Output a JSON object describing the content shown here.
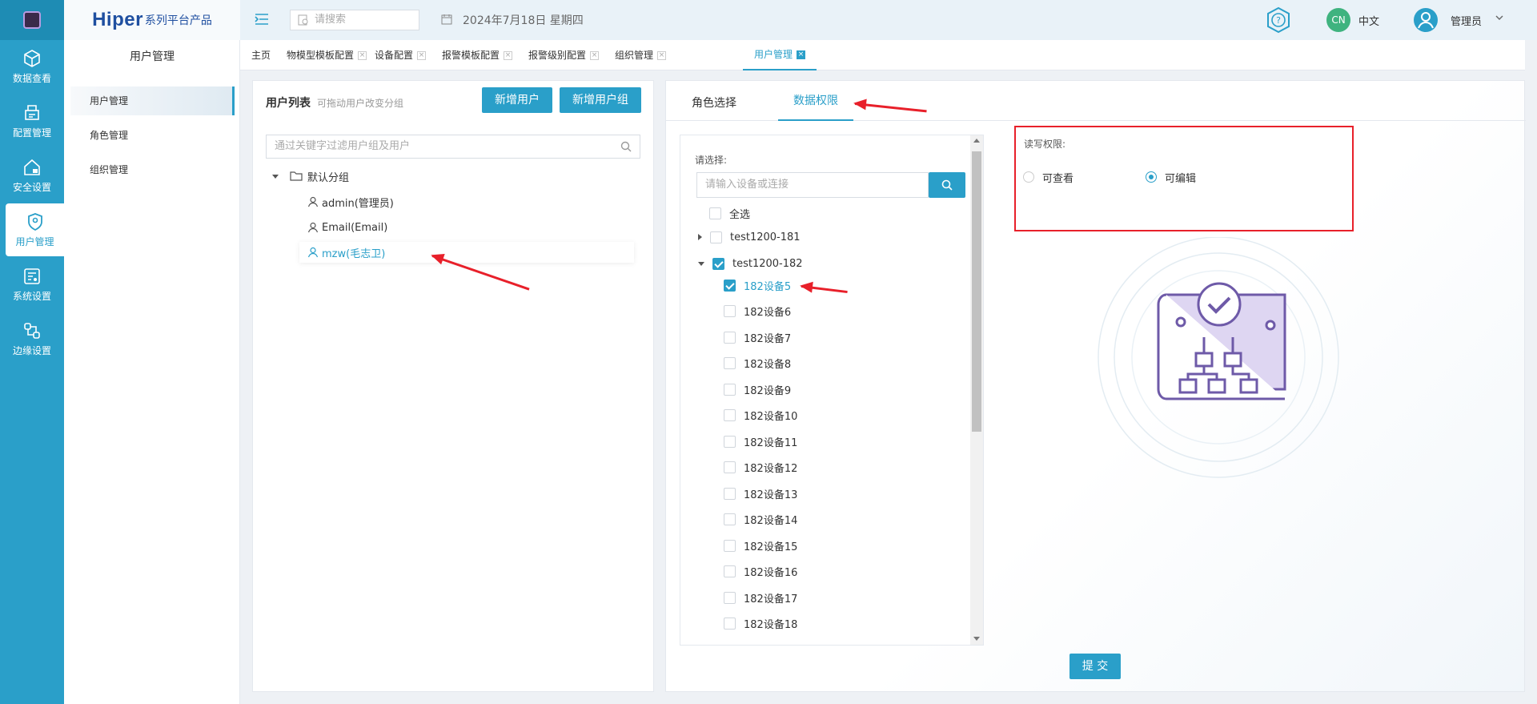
{
  "rail": {
    "items": [
      {
        "label": "数据查看",
        "icon": "cube-icon"
      },
      {
        "label": "配置管理",
        "icon": "printer-config-icon"
      },
      {
        "label": "安全设置",
        "icon": "home-lock-icon"
      },
      {
        "label": "用户管理",
        "icon": "shield-user-icon",
        "active": true
      },
      {
        "label": "系统设置",
        "icon": "settings-panel-icon"
      },
      {
        "label": "边缘设置",
        "icon": "edge-nodes-icon"
      }
    ]
  },
  "brand": {
    "name": "Hiper",
    "suffix": "系列平台产品"
  },
  "submenu": {
    "title": "用户管理",
    "items": [
      {
        "label": "用户管理",
        "active": true
      },
      {
        "label": "角色管理"
      },
      {
        "label": "组织管理"
      }
    ]
  },
  "topbar": {
    "search_placeholder": "请搜索",
    "date": "2024年7月18日 星期四",
    "lang_badge": "CN",
    "lang_label": "中文",
    "user": "管理员"
  },
  "tabs": [
    {
      "label": "主页",
      "closable": false
    },
    {
      "label": "物模型模板配置",
      "closable": true
    },
    {
      "label": "设备配置",
      "closable": true
    },
    {
      "label": "报警模板配置",
      "closable": true
    },
    {
      "label": "报警级别配置",
      "closable": true
    },
    {
      "label": "组织管理",
      "closable": true
    },
    {
      "label": "用户管理",
      "closable": true,
      "active": true
    }
  ],
  "user_list": {
    "title": "用户列表",
    "hint": "可拖动用户改变分组",
    "add_user": "新增用户",
    "add_group": "新增用户组",
    "filter_placeholder": "通过关键字过滤用户组及用户",
    "group": "默认分组",
    "users": [
      {
        "label": "admin(管理员)"
      },
      {
        "label": "Email(Email)"
      },
      {
        "label": "mzw(毛志卫)",
        "selected": true
      }
    ]
  },
  "right": {
    "tabs": [
      {
        "label": "角色选择"
      },
      {
        "label": "数据权限",
        "active": true
      }
    ],
    "select_label": "请选择:",
    "device_placeholder": "请输入设备或连接",
    "select_all": "全选",
    "nodes": [
      {
        "label": "test1200-181",
        "expanded": false,
        "checked": false
      },
      {
        "label": "test1200-182",
        "expanded": true,
        "checked": true
      }
    ],
    "devices": [
      {
        "label": "182设备5",
        "checked": true
      },
      {
        "label": "182设备6",
        "checked": false
      },
      {
        "label": "182设备7",
        "checked": false
      },
      {
        "label": "182设备8",
        "checked": false
      },
      {
        "label": "182设备9",
        "checked": false
      },
      {
        "label": "182设备10",
        "checked": false
      },
      {
        "label": "182设备11",
        "checked": false
      },
      {
        "label": "182设备12",
        "checked": false
      },
      {
        "label": "182设备13",
        "checked": false
      },
      {
        "label": "182设备14",
        "checked": false
      },
      {
        "label": "182设备15",
        "checked": false
      },
      {
        "label": "182设备16",
        "checked": false
      },
      {
        "label": "182设备17",
        "checked": false
      },
      {
        "label": "182设备18",
        "checked": false
      }
    ],
    "rw_label": "读写权限:",
    "rw_options": [
      {
        "label": "可查看",
        "selected": false
      },
      {
        "label": "可编辑",
        "selected": true
      }
    ],
    "submit": "提 交"
  },
  "colors": {
    "accent": "#2a9fc9",
    "annotation": "#e8202a"
  }
}
